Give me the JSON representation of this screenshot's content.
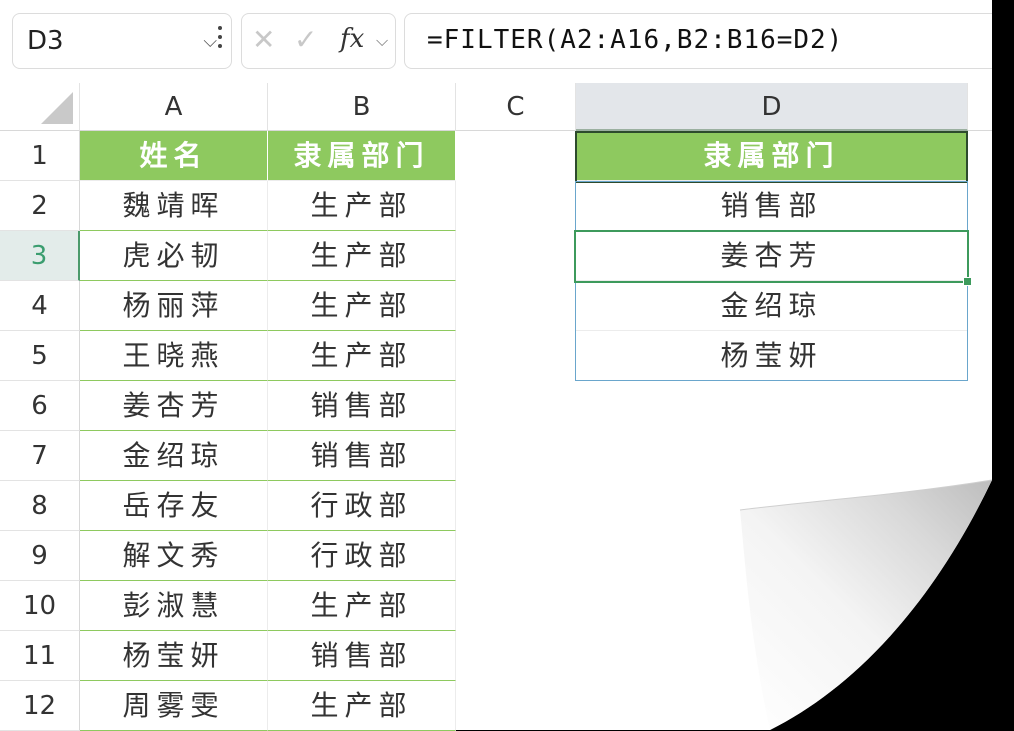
{
  "formula_bar": {
    "name_box": "D3",
    "fx_label": "fx",
    "formula": "=FILTER(A2:A16,B2:B16=D2)"
  },
  "columns": [
    "A",
    "B",
    "C",
    "D"
  ],
  "rows": [
    "1",
    "2",
    "3",
    "4",
    "5",
    "6",
    "7",
    "8",
    "9",
    "10",
    "11",
    "12"
  ],
  "table": {
    "headers": [
      "姓名",
      "隶属部门"
    ],
    "rows": [
      [
        "魏靖晖",
        "生产部"
      ],
      [
        "虎必韧",
        "生产部"
      ],
      [
        "杨丽萍",
        "生产部"
      ],
      [
        "王晓燕",
        "生产部"
      ],
      [
        "姜杏芳",
        "销售部"
      ],
      [
        "金绍琼",
        "销售部"
      ],
      [
        "岳存友",
        "行政部"
      ],
      [
        "解文秀",
        "行政部"
      ],
      [
        "彭淑慧",
        "生产部"
      ],
      [
        "杨莹妍",
        "销售部"
      ],
      [
        "周雾雯",
        "生产部"
      ]
    ]
  },
  "filter_panel": {
    "header": "隶属部门",
    "criteria": "销售部",
    "results": [
      "姜杏芳",
      "金绍琼",
      "杨莹妍"
    ]
  },
  "selected_cell": "D3",
  "colors": {
    "header_green": "#8ec95f",
    "selection_green": "#3d9a5c",
    "spill_blue": "#6aa6cc"
  }
}
